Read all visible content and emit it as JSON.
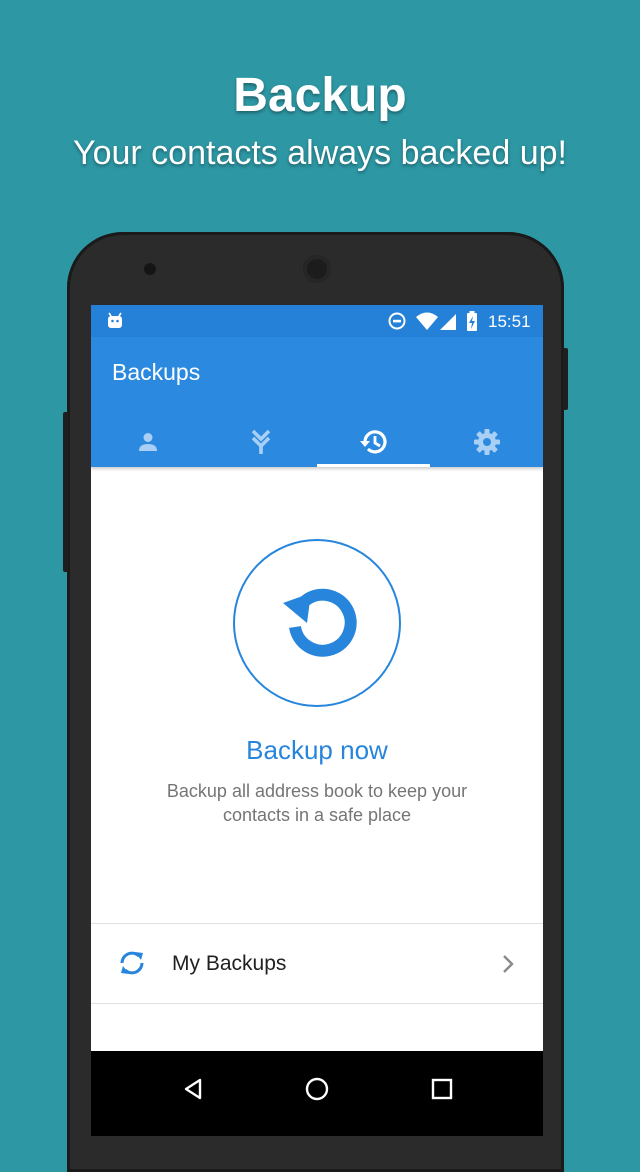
{
  "promo": {
    "title": "Backup",
    "subtitle": "Your contacts always backed up!"
  },
  "status_bar": {
    "time": "15:51",
    "icons": [
      "android-icon",
      "do-not-disturb-icon",
      "wifi-icon",
      "signal-icon",
      "battery-charging-icon"
    ]
  },
  "app_bar": {
    "title": "Backups",
    "tabs": [
      {
        "icon": "person-icon",
        "selected": false
      },
      {
        "icon": "merge-icon",
        "selected": false
      },
      {
        "icon": "history-icon",
        "selected": true
      },
      {
        "icon": "gear-icon",
        "selected": false
      }
    ]
  },
  "backup": {
    "button_icon": "restore-icon",
    "title": "Backup now",
    "description": "Backup all address book to keep your contacts in a safe place"
  },
  "list": {
    "items": [
      {
        "icon": "sync-icon",
        "label": "My Backups",
        "trailing_icon": "chevron-right-icon"
      }
    ]
  },
  "nav_bar": {
    "buttons": [
      "back-icon",
      "home-icon",
      "recents-icon"
    ]
  },
  "colors": {
    "background": "#2d97a4",
    "primary": "#2b8adf",
    "primary_dark": "#2581d7",
    "accent_text": "#2785dc"
  }
}
